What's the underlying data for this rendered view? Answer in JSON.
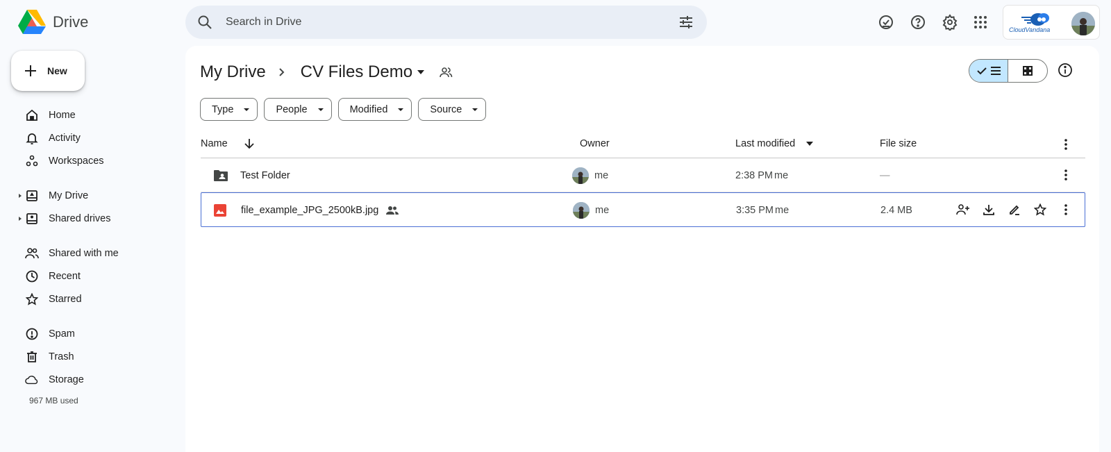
{
  "app": {
    "name": "Drive"
  },
  "search": {
    "placeholder": "Search in Drive"
  },
  "new_button": {
    "label": "New"
  },
  "sidebar": {
    "items": [
      {
        "label": "Home",
        "icon": "home-icon"
      },
      {
        "label": "Activity",
        "icon": "bell-icon"
      },
      {
        "label": "Workspaces",
        "icon": "workspaces-icon"
      },
      {
        "label": "My Drive",
        "icon": "my-drive-icon"
      },
      {
        "label": "Shared drives",
        "icon": "shared-drives-icon"
      },
      {
        "label": "Shared with me",
        "icon": "people-icon"
      },
      {
        "label": "Recent",
        "icon": "clock-icon"
      },
      {
        "label": "Starred",
        "icon": "star-icon"
      },
      {
        "label": "Spam",
        "icon": "spam-icon"
      },
      {
        "label": "Trash",
        "icon": "trash-icon"
      },
      {
        "label": "Storage",
        "icon": "cloud-icon"
      }
    ],
    "storage_used": "967 MB used"
  },
  "account": {
    "brand_text": "CloudVandana"
  },
  "breadcrumb": {
    "root": "My Drive",
    "current": "CV Files Demo"
  },
  "filters": [
    "Type",
    "People",
    "Modified",
    "Source"
  ],
  "table": {
    "headers": {
      "name": "Name",
      "owner": "Owner",
      "modified": "Last modified",
      "size": "File size"
    },
    "rows": [
      {
        "name": "Test Folder",
        "owner": "me",
        "modified": "2:38 PM",
        "modified_by": "me",
        "size": "—",
        "type": "shared-folder"
      },
      {
        "name": "file_example_JPG_2500kB.jpg",
        "owner": "me",
        "modified": "3:35 PM",
        "modified_by": "me",
        "size": "2.4 MB",
        "type": "image"
      }
    ]
  },
  "colors": {
    "accent": "#c2e7ff",
    "selected_border": "#4a6fd4",
    "image_red": "#ea4335"
  }
}
